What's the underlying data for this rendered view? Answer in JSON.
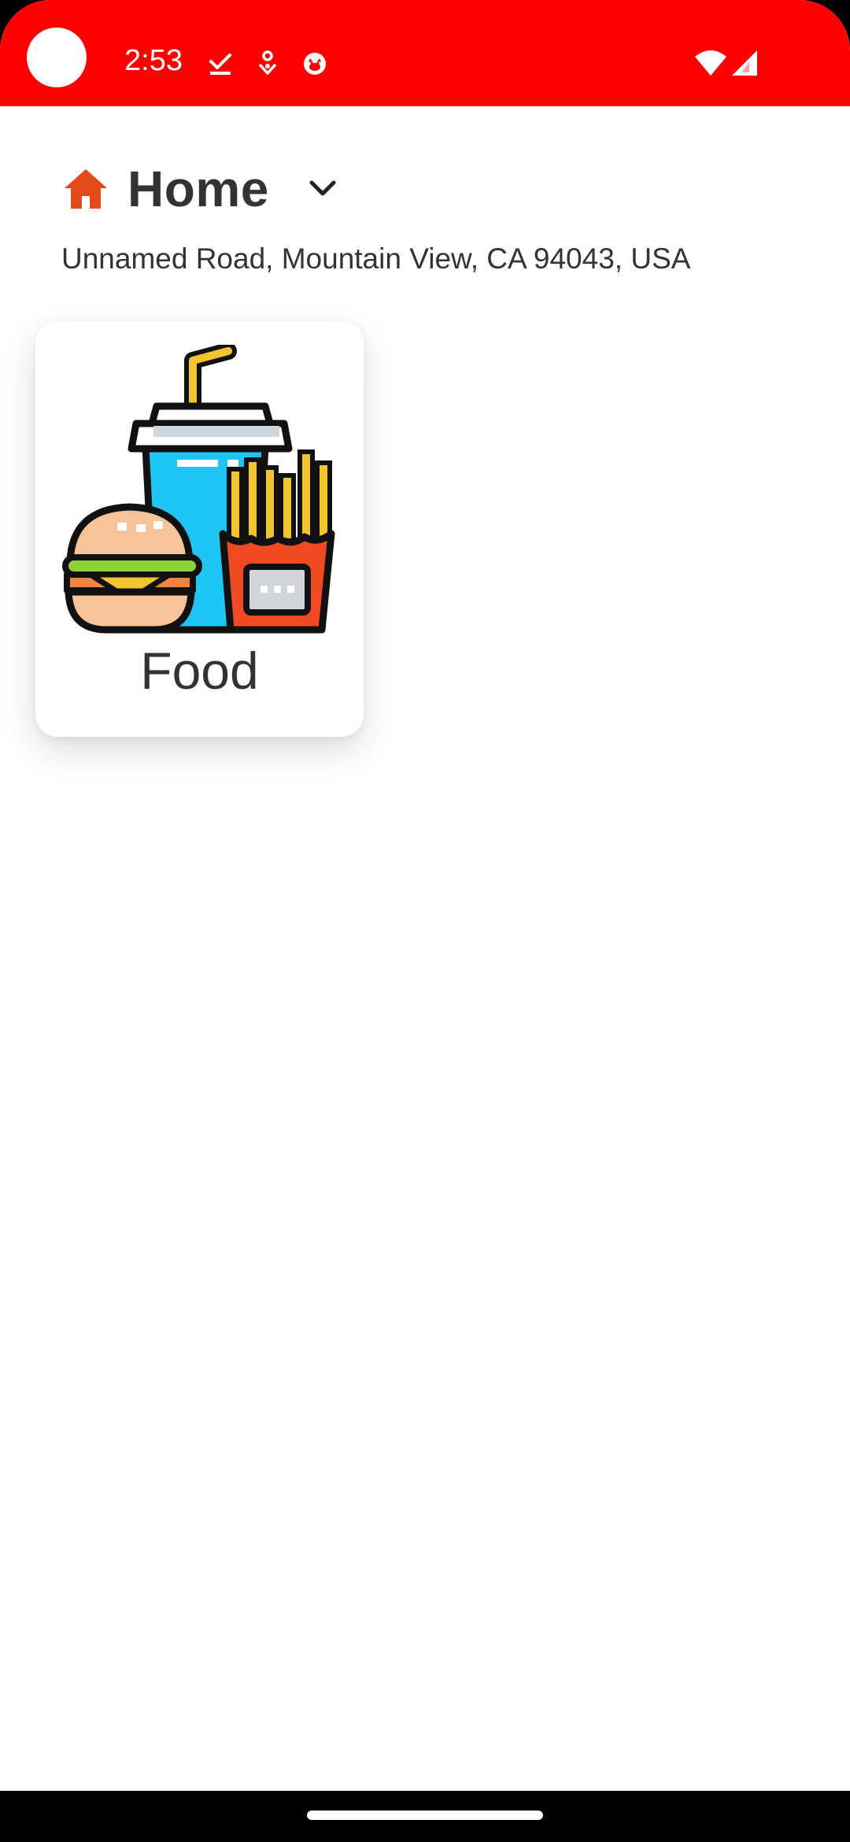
{
  "status_bar": {
    "time": "2:53",
    "background_color": "#ff0000",
    "icons": [
      "checkmark-download-icon",
      "location-pin-icon",
      "cat-face-icon",
      "wifi-icon",
      "cell-signal-icon"
    ]
  },
  "header": {
    "title": "Home",
    "icon": "home-icon",
    "icon_color": "#e24a1c",
    "dropdown_icon": "chevron-down-icon",
    "address": "Unnamed Road, Mountain View, CA 94043, USA"
  },
  "categories": [
    {
      "label": "Food",
      "icon": "fast-food-illustration"
    }
  ]
}
